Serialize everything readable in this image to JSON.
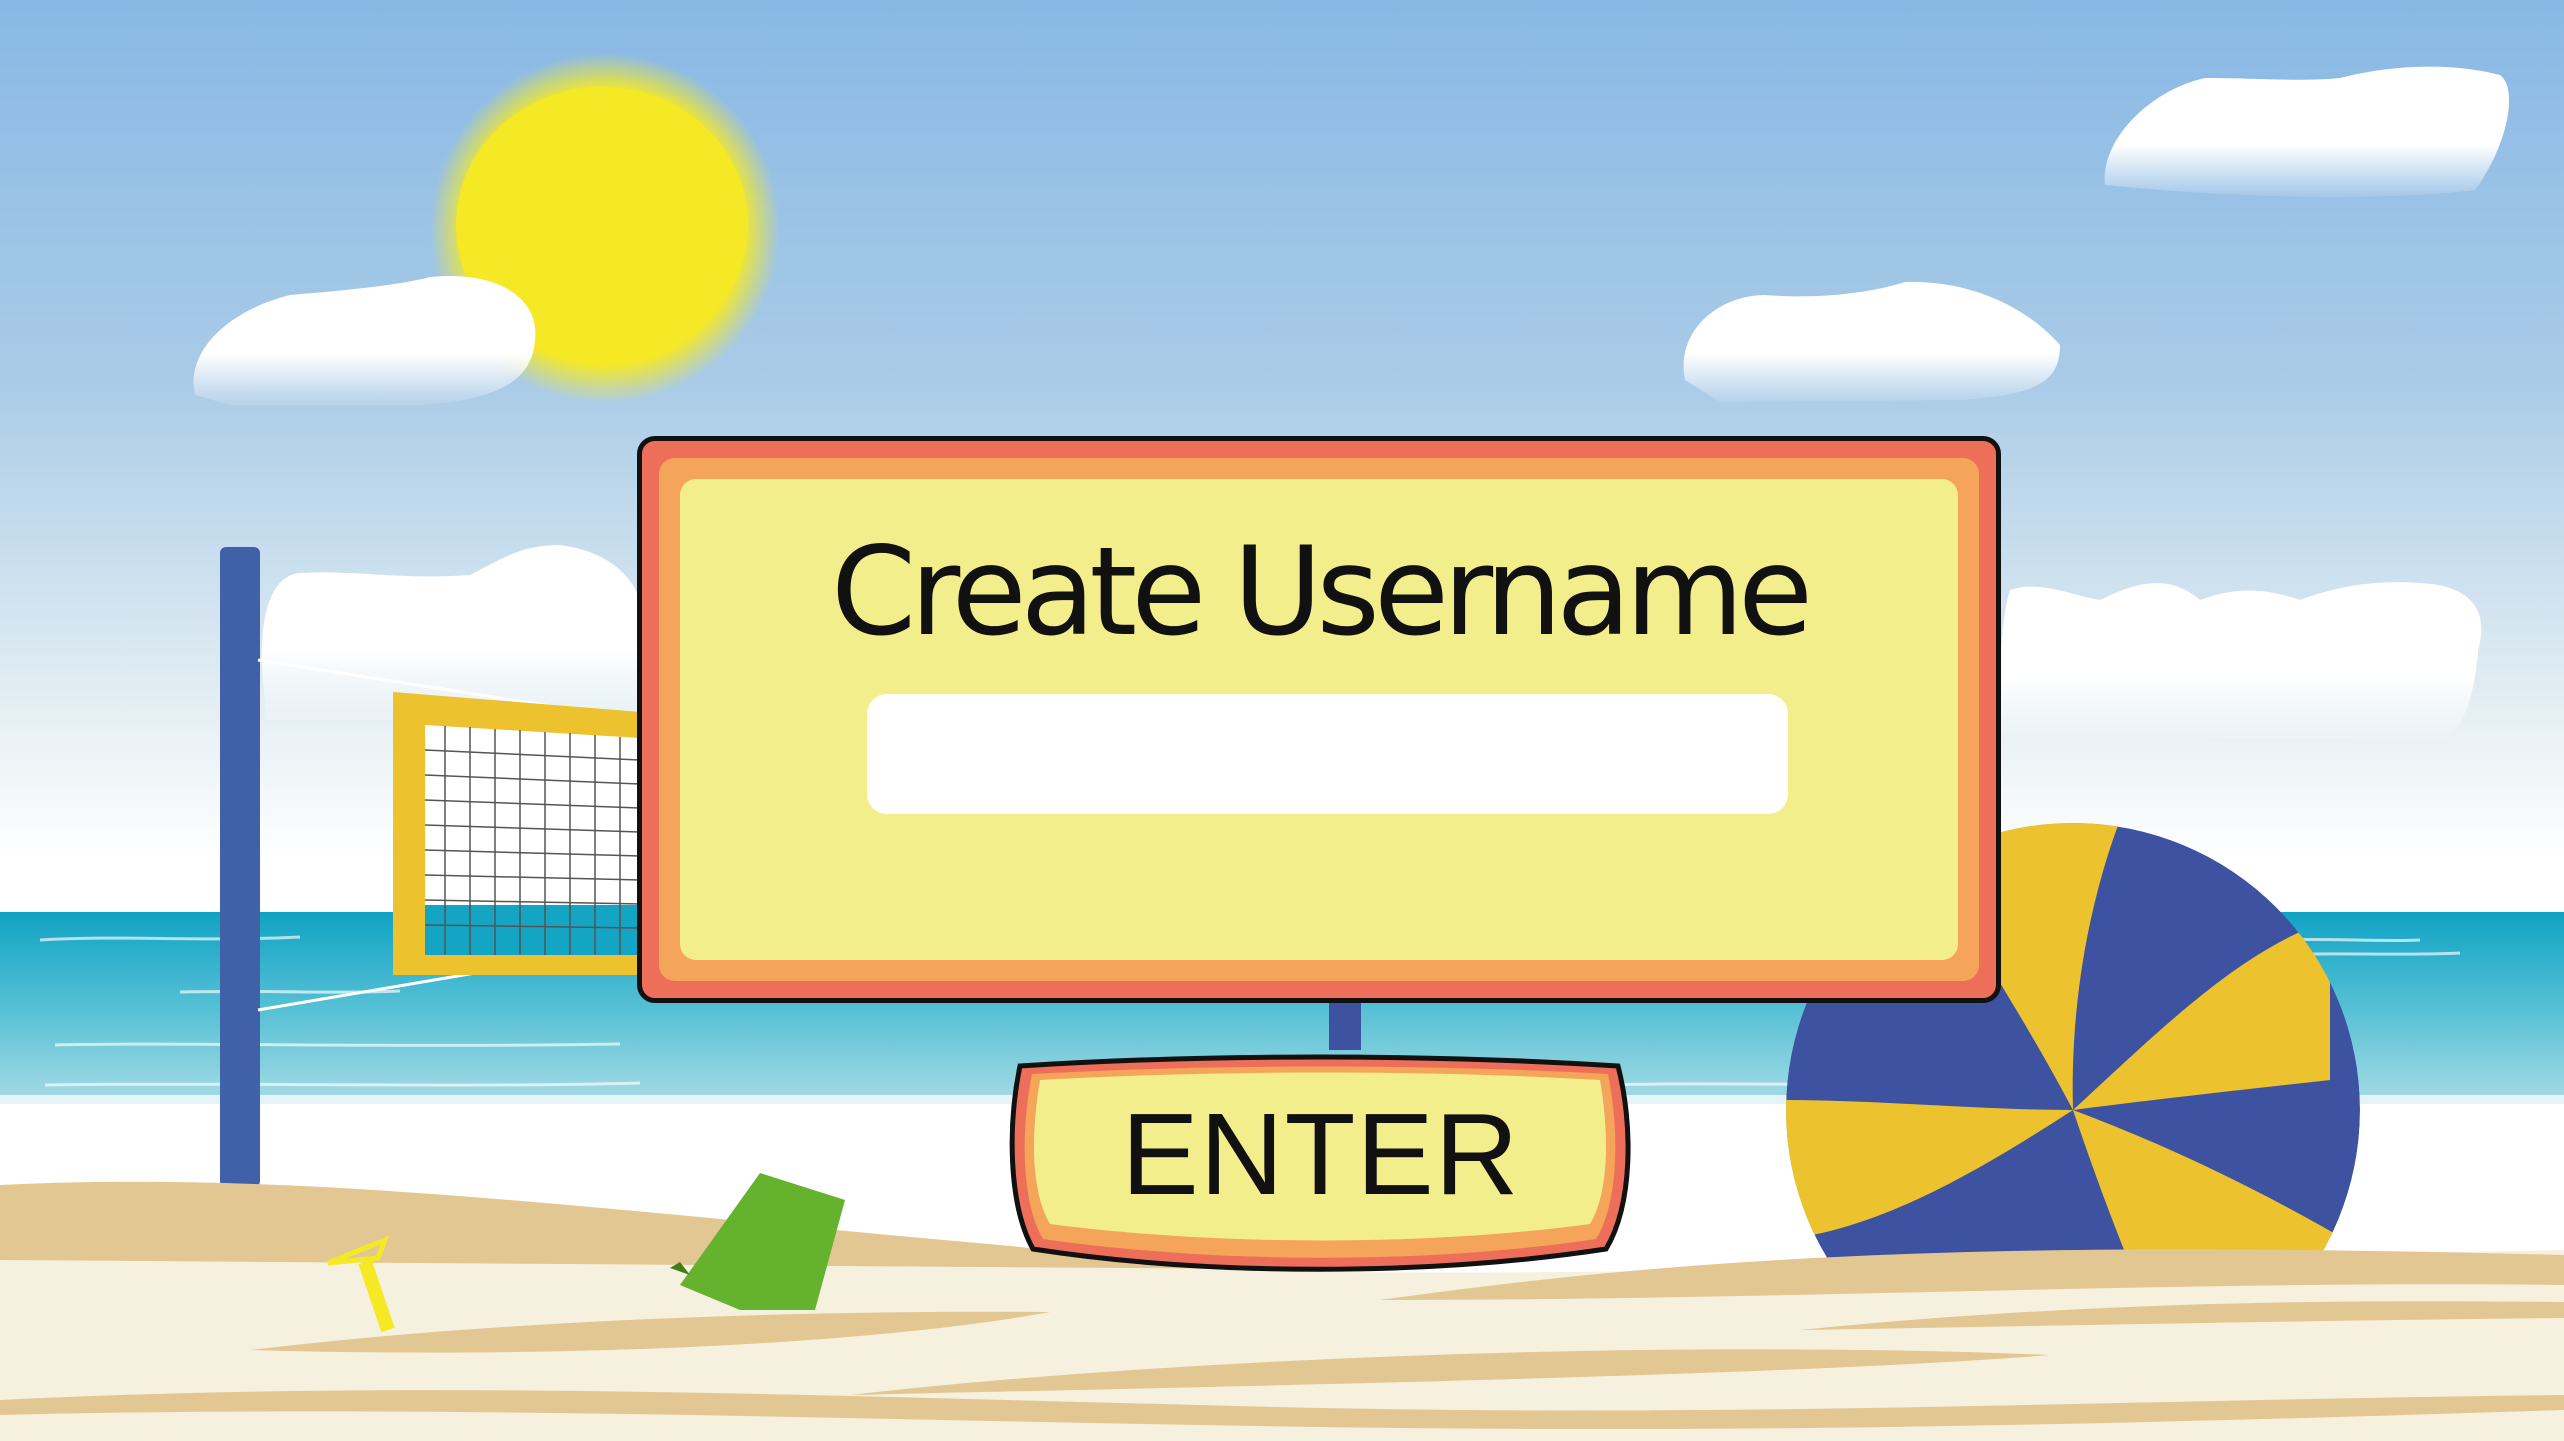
{
  "signboard": {
    "title": "Create Username",
    "input_value": "",
    "input_placeholder": ""
  },
  "enter_button": {
    "label": "ENTER"
  },
  "colors": {
    "sign_frame": "#ee6f59",
    "sign_trim": "#f4a55a",
    "sign_panel": "#f3ee8c",
    "sky": "#88b8e5",
    "sea": "#14a5c5",
    "sand": "#f6f1df",
    "dune": "#e2c793",
    "sun": "#f5e926",
    "ball_blue": "#3d52a0",
    "ball_yellow": "#ecc22f"
  }
}
